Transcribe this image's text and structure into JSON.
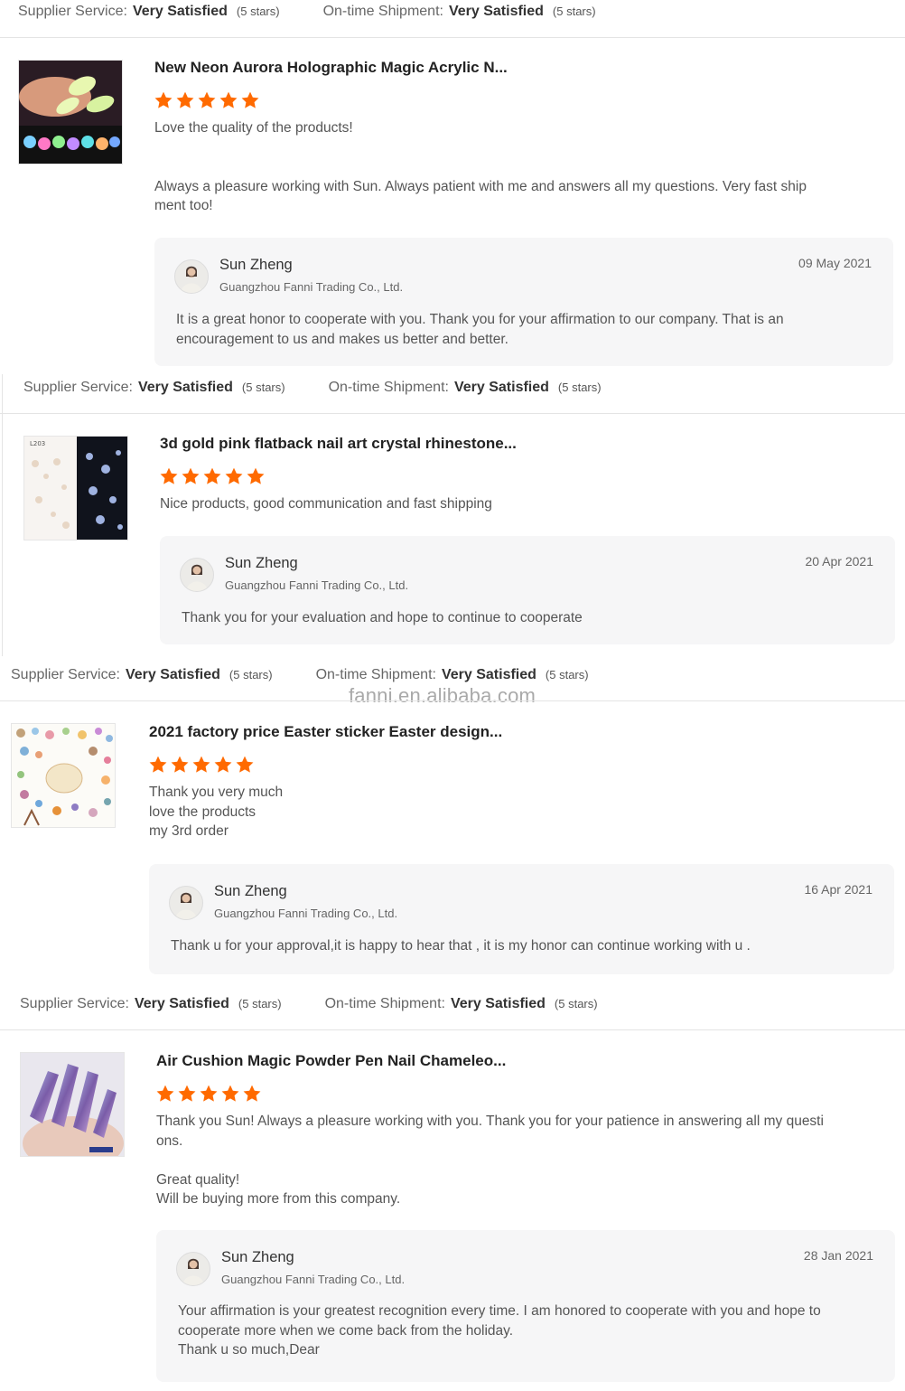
{
  "ratings": {
    "service_label": "Supplier Service:",
    "shipment_label": "On-time Shipment:",
    "value": "Very Satisfied",
    "stars_note": "(5 stars)"
  },
  "watermark": "fanni.en.alibaba.com",
  "star_color": "#ff6a00",
  "reviews": [
    {
      "product_title": "New Neon Aurora Holographic Magic Acrylic N...",
      "stars": 5,
      "comment": "Love the quality of the products!\n\n\nAlways a pleasure working with Sun. Always patient with me and answers all my questions. Very fast ship\nment too!",
      "reply": {
        "name": "Sun Zheng",
        "company": "Guangzhou Fanni Trading Co., Ltd.",
        "date": "09 May 2021",
        "text": "It is a great honor to cooperate with you. Thank you for your affirmation to our company. That is an\nencouragement to us and makes us better and better."
      }
    },
    {
      "product_title": "3d gold pink flatback nail art crystal rhinestone...",
      "stars": 5,
      "comment": "Nice products, good communication and fast shipping",
      "reply": {
        "name": "Sun Zheng",
        "company": "Guangzhou Fanni Trading Co., Ltd.",
        "date": "20 Apr 2021",
        "text": "Thank you for your evaluation and hope to continue to cooperate"
      }
    },
    {
      "product_title": "2021 factory price Easter sticker Easter design...",
      "stars": 5,
      "comment": "Thank you very much\nlove the products\nmy 3rd order",
      "reply": {
        "name": "Sun Zheng",
        "company": "Guangzhou Fanni Trading Co., Ltd.",
        "date": "16 Apr 2021",
        "text": "Thank u for your approval,it is happy to hear that , it is  my honor can continue working with u ."
      }
    },
    {
      "product_title": "Air Cushion Magic Powder Pen Nail Chameleo...",
      "stars": 5,
      "comment": "Thank you Sun! Always a pleasure working with you. Thank you for your patience in answering all my questi\nons.\n\n Great quality!\nWill be buying more from this company.",
      "reply": {
        "name": "Sun Zheng",
        "company": "Guangzhou Fanni Trading Co., Ltd.",
        "date": "28 Jan 2021",
        "text": "Your affirmation is your greatest recognition every time. I am honored to cooperate with you and hope to\ncooperate more when we come back from the holiday.\nThank u so much,Dear"
      }
    }
  ]
}
